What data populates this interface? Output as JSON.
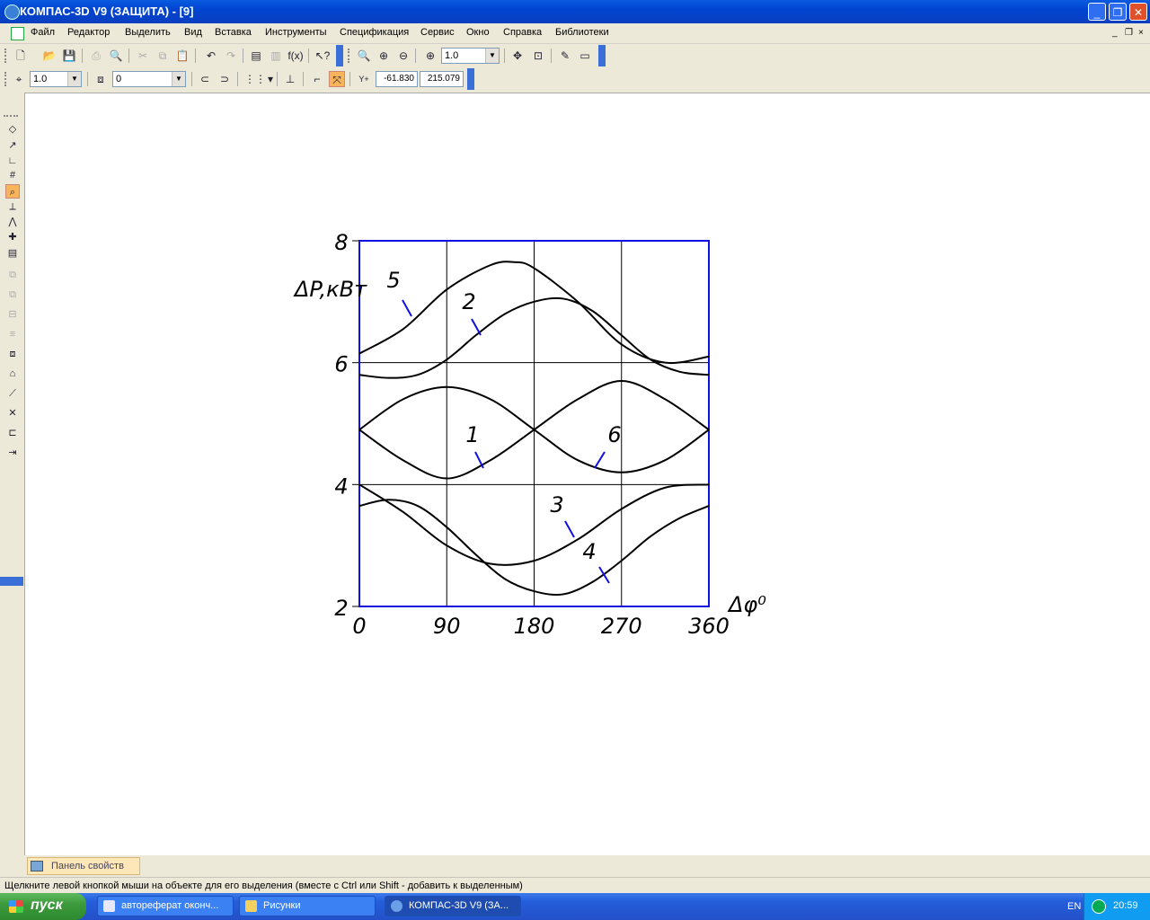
{
  "window": {
    "title": "КОМПАС-3D V9 (ЗАЩИТА) - [9]"
  },
  "menu": {
    "items": [
      "Файл",
      "Редактор",
      "Выделить",
      "Вид",
      "Вставка",
      "Инструменты",
      "Спецификация",
      "Сервис",
      "Окно",
      "Справка",
      "Библиотеки"
    ],
    "mdi_controls": [
      "_",
      "❐",
      "×"
    ]
  },
  "toolbar": {
    "zoom_value": "1.0",
    "step_value": "1.0",
    "layer_value": "0",
    "coord_x": "-61.830",
    "coord_y": "215.079",
    "coord_label": "Y+"
  },
  "chart_data": {
    "type": "line",
    "xlabel": "Δφ⁰",
    "ylabel": "ΔP,кВт",
    "x_ticks": [
      "0",
      "90",
      "180",
      "270",
      "360"
    ],
    "y_ticks": [
      "2",
      "4",
      "6",
      "8"
    ],
    "xlim": [
      0,
      360
    ],
    "ylim": [
      2,
      8
    ],
    "grid": true,
    "series": [
      {
        "name": "1",
        "x": [
          0,
          45,
          90,
          135,
          180,
          225,
          270,
          315,
          360
        ],
        "values": [
          4.9,
          4.4,
          4.1,
          4.4,
          4.9,
          5.4,
          5.7,
          5.4,
          4.9
        ]
      },
      {
        "name": "2",
        "x": [
          0,
          30,
          60,
          90,
          120,
          150,
          180,
          210,
          240,
          270,
          300,
          330,
          360
        ],
        "values": [
          5.8,
          5.75,
          5.8,
          6.05,
          6.45,
          6.8,
          7.0,
          7.05,
          6.85,
          6.45,
          6.05,
          5.85,
          5.8
        ]
      },
      {
        "name": "3",
        "x": [
          0,
          45,
          90,
          135,
          180,
          225,
          270,
          315,
          360
        ],
        "values": [
          4.0,
          3.55,
          3.0,
          2.7,
          2.75,
          3.1,
          3.6,
          3.95,
          4.0
        ]
      },
      {
        "name": "4",
        "x": [
          0,
          30,
          60,
          90,
          120,
          150,
          180,
          210,
          240,
          270,
          300,
          330,
          360
        ],
        "values": [
          3.65,
          3.75,
          3.65,
          3.3,
          2.85,
          2.45,
          2.25,
          2.2,
          2.4,
          2.75,
          3.15,
          3.45,
          3.65
        ]
      },
      {
        "name": "5",
        "x": [
          0,
          45,
          90,
          135,
          160,
          180,
          225,
          270,
          315,
          360
        ],
        "values": [
          6.15,
          6.55,
          7.2,
          7.6,
          7.65,
          7.55,
          7.0,
          6.3,
          6.0,
          6.1
        ]
      },
      {
        "name": "6",
        "x": [
          0,
          45,
          90,
          135,
          180,
          225,
          270,
          315,
          360
        ],
        "values": [
          4.9,
          5.4,
          5.6,
          5.4,
          4.9,
          4.4,
          4.2,
          4.4,
          4.9
        ]
      }
    ],
    "curve_labels": [
      "5",
      "2",
      "1",
      "6",
      "3",
      "4"
    ]
  },
  "panels": {
    "properties_tab": "Панель свойств"
  },
  "status": {
    "hint": "Щелкните левой кнопкой мыши на объекте для его выделения (вместе с Ctrl или Shift - добавить к выделенным)"
  },
  "taskbar": {
    "start_label": "пуск",
    "tasks": [
      "автореферат оконч...",
      "Рисунки",
      "КОМПАС-3D V9 (ЗА..."
    ],
    "language": "EN",
    "clock": "20:59"
  }
}
